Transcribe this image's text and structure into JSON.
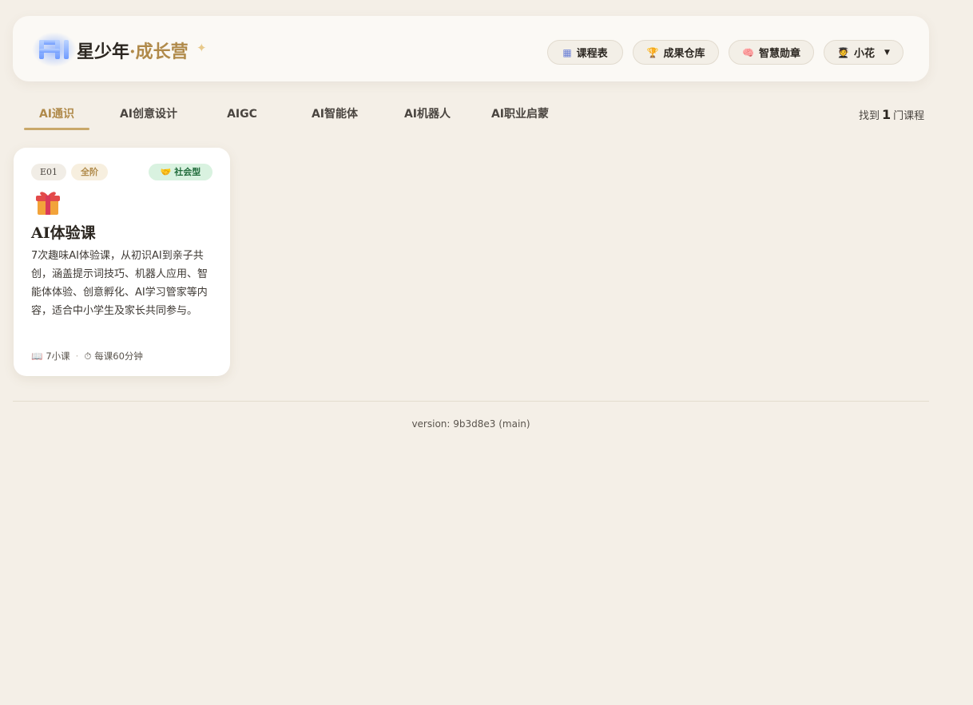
{
  "header": {
    "logo_text": "AI",
    "brand_main": "星少年",
    "brand_sub": "·成长营",
    "sparkle": "✦",
    "nav": [
      {
        "icon": "calendar-icon",
        "glyph": "▦",
        "label": "课程表"
      },
      {
        "icon": "trophy-icon",
        "glyph": "🏆",
        "label": "成果仓库"
      },
      {
        "icon": "brain-icon",
        "glyph": "🧠",
        "label": "智慧勋章"
      }
    ],
    "user": {
      "icon": "student-avatar-icon",
      "glyph": "🧑‍🎓",
      "name": "小花",
      "caret": "▼"
    }
  },
  "tabs": [
    {
      "label": "AI通识",
      "active": true
    },
    {
      "label": "AI创意设计",
      "active": false
    },
    {
      "label": "AIGC",
      "active": false
    },
    {
      "label": "AI智能体",
      "active": false
    },
    {
      "label": "AI机器人",
      "active": false
    },
    {
      "label": "AI职业启蒙",
      "active": false
    }
  ],
  "result": {
    "prefix": "找到",
    "count": "1",
    "suffix": "门课程"
  },
  "card": {
    "code": "E01",
    "level": "全阶",
    "type_icon": "handshake-icon",
    "type_glyph": "🤝",
    "type_label": "社会型",
    "icon": "gift-icon",
    "title": "AI体验课",
    "description": "7次趣味AI体验课，从初识AI到亲子共创，涵盖提示词技巧、机器人应用、智能体体验、创意孵化、AI学习管家等内容，适合中小学生及家长共同参与。",
    "lessons_glyph": "📖",
    "lessons": "7小课",
    "dot": "·",
    "duration_glyph": "⏱",
    "duration": "每课60分钟"
  },
  "footer": {
    "version": "version: 9b3d8e3 (main)"
  },
  "colors": {
    "accent": "#b08a4a",
    "background": "#f4efe7",
    "type_badge_bg": "#d9f2e0"
  }
}
